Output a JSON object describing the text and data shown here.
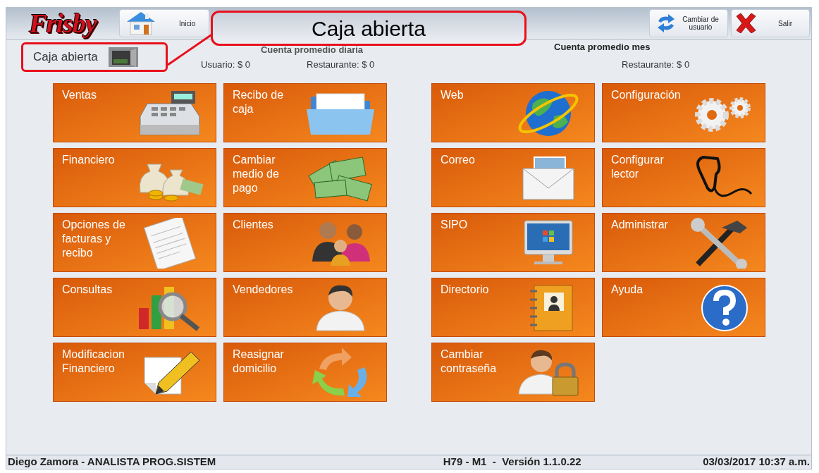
{
  "header": {
    "logo": "Frisby",
    "home_button": "Inicio",
    "switch_user_button": "Cambiar de usuario",
    "exit_button": "Salir"
  },
  "callout": {
    "text": "Caja abierta"
  },
  "cash_status": {
    "label": "Caja abierta"
  },
  "daily_average": {
    "title": "Cuenta promedio diaria",
    "user": "Usuario: $ 0",
    "restaurant": "Restaurante: $ 0"
  },
  "monthly_average": {
    "title": "Cuenta promedio mes",
    "restaurant": "Restaurante: $ 0"
  },
  "tile_groups": [
    [
      {
        "lines": [
          "Ventas"
        ]
      },
      {
        "lines": [
          "Recibo de",
          "caja"
        ]
      },
      {
        "lines": [
          "Financiero"
        ]
      },
      {
        "lines": [
          "Cambiar",
          "medio de",
          "pago"
        ]
      },
      {
        "lines": [
          "Opciones de",
          "facturas y",
          "recibo"
        ]
      },
      {
        "lines": [
          "Clientes"
        ]
      },
      {
        "lines": [
          "Consultas"
        ]
      },
      {
        "lines": [
          "Vendedores"
        ]
      },
      {
        "lines": [
          "Modificacion",
          "Financiero"
        ]
      },
      {
        "lines": [
          "Reasignar",
          "domicilio"
        ]
      }
    ],
    [
      {
        "lines": [
          "Web"
        ]
      },
      {
        "lines": [
          "Configuración"
        ]
      },
      {
        "lines": [
          "Correo"
        ]
      },
      {
        "lines": [
          "Configurar",
          "lector"
        ]
      },
      {
        "lines": [
          "SIPO"
        ]
      },
      {
        "lines": [
          "Administrar"
        ]
      },
      {
        "lines": [
          "Directorio"
        ]
      },
      {
        "lines": [
          "Ayuda"
        ]
      },
      {
        "lines": [
          "Cambiar",
          "contraseña"
        ]
      }
    ]
  ],
  "status_bar": {
    "user": "Diego Zamora - ANALISTA PROG.SISTEM",
    "version": "H79 - M1  -  Versión 1.1.0.22",
    "datetime": "03/03/2017 10:37 a.m."
  }
}
